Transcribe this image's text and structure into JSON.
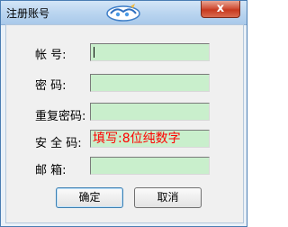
{
  "window": {
    "title": "注册账号",
    "close_label": "x"
  },
  "form": {
    "account_label": "帐    号:",
    "password_label": "密    码:",
    "confirm_password_label": "重复密码:",
    "security_code_label": "安 全 码:",
    "email_label": "邮    箱:",
    "security_code_value": "填写:8位纯数字"
  },
  "buttons": {
    "ok_label": "确定",
    "cancel_label": "取消"
  }
}
